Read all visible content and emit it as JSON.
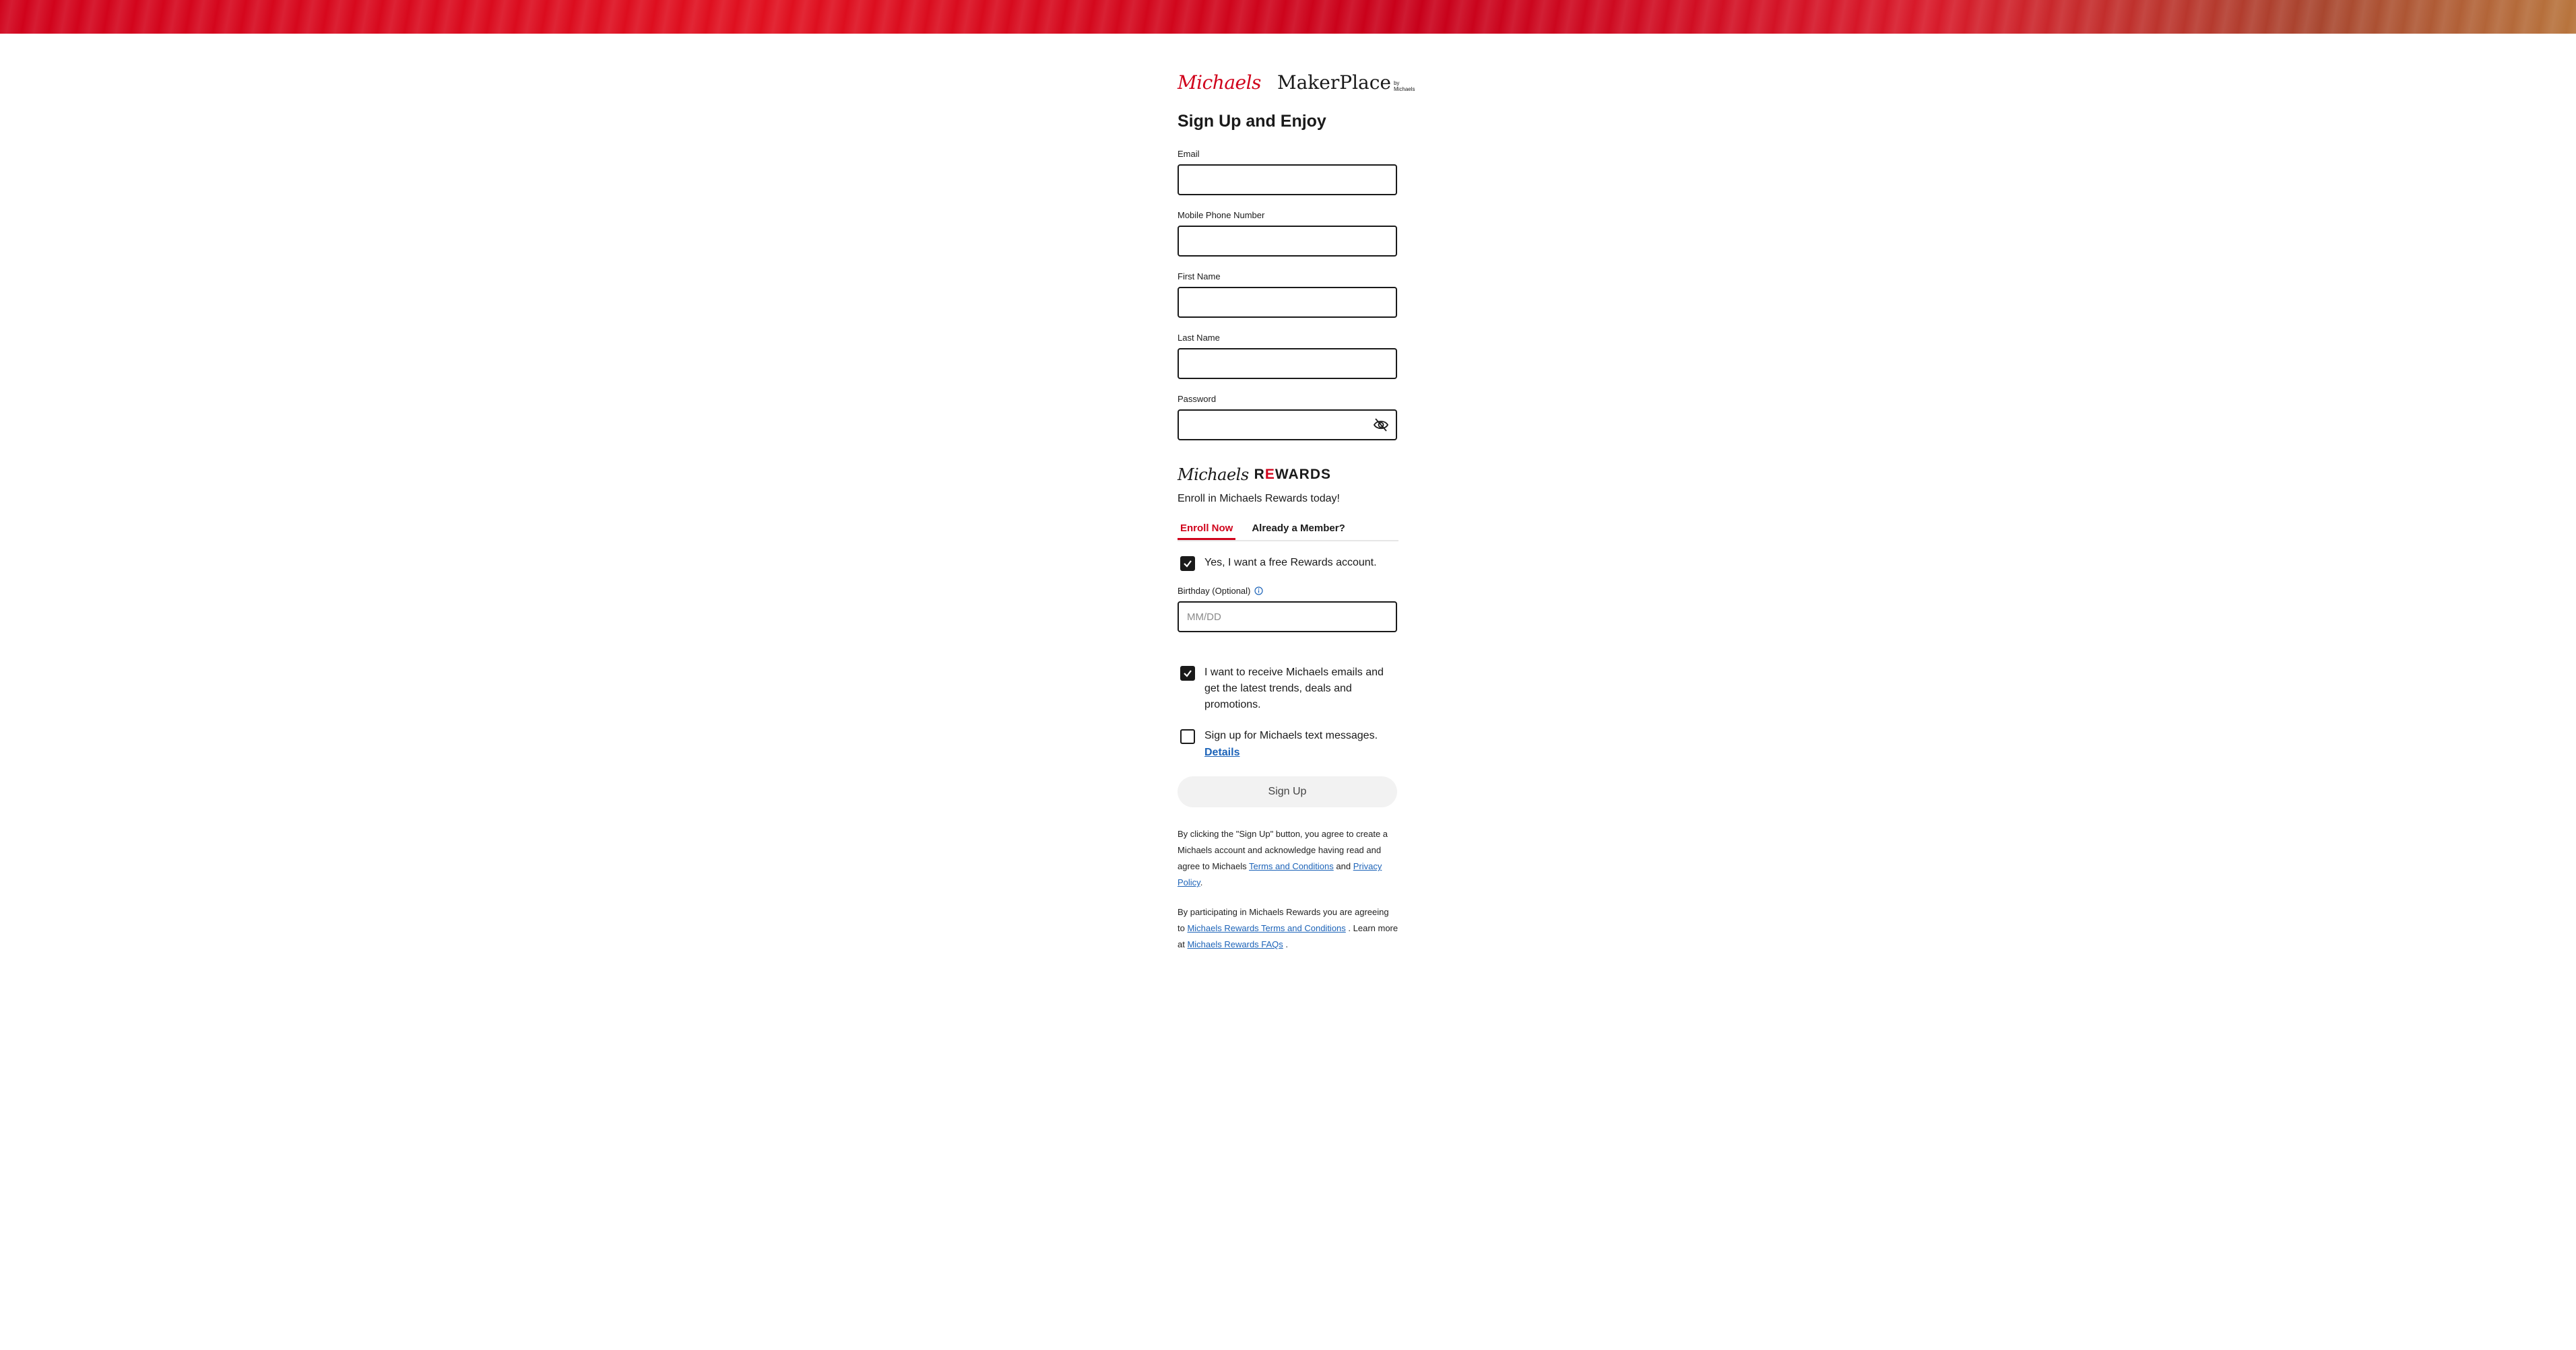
{
  "brand": {
    "michaels": "Michaels",
    "makerplace": "MakerPlace",
    "by": "by Michaels"
  },
  "form": {
    "title": "Sign Up and Enjoy",
    "email_label": "Email",
    "phone_label": "Mobile Phone Number",
    "first_name_label": "First Name",
    "last_name_label": "Last Name",
    "password_label": "Password"
  },
  "rewards": {
    "logo_script": "Michaels",
    "logo_word_r": "R",
    "logo_word_e": "E",
    "logo_word_rest": "WARDS",
    "enroll_text": "Enroll in Michaels Rewards today!",
    "tabs": [
      {
        "label": "Enroll Now",
        "active": true
      },
      {
        "label": "Already a Member?",
        "active": false
      }
    ],
    "free_account_text": "Yes, I want a free Rewards account.",
    "birthday_label": "Birthday (Optional)",
    "birthday_placeholder": "MM/DD",
    "emails_text": "I want to receive Michaels emails and get the latest trends, deals and promotions.",
    "sms_text": "Sign up for Michaels text messages.",
    "details_link": "Details"
  },
  "checkbox_states": {
    "free_account": true,
    "emails": true,
    "sms": false
  },
  "signup_button": "Sign Up",
  "legal": {
    "p1_text": "By clicking the \"Sign Up\" button, you agree to create a Michaels account and acknowledge having read and agree to Michaels",
    "terms_link": "Terms and Conditions",
    "and": "and",
    "privacy_link": "Privacy Policy",
    "period": ".",
    "p2_text": "By participating in Michaels Rewards you are agreeing to",
    "rewards_terms_link": "Michaels Rewards Terms and Conditions",
    "learn_more": ". Learn more at",
    "faqs_link": "Michaels Rewards FAQs",
    "p2_end": "."
  },
  "colors": {
    "brand_red": "#d0021b",
    "link_blue": "#1c63b8"
  }
}
